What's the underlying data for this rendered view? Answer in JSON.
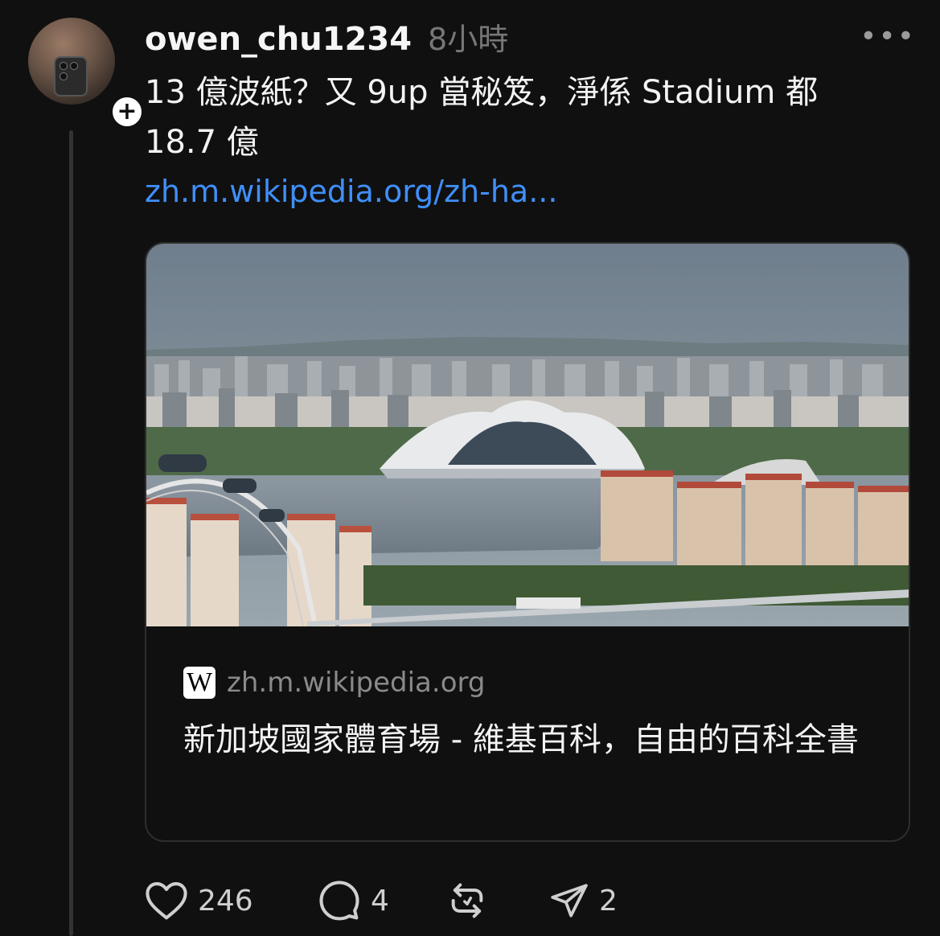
{
  "post": {
    "username": "owen_chu1234",
    "time": "8小時",
    "more_label": "•••",
    "follow_label": "+",
    "text": "13 億波紙？又 9up 當秘笈，淨係 Stadium 都 18.7 億",
    "link_text": "zh.m.wikipedia.org/zh-ha..."
  },
  "link_card": {
    "site_icon_letter": "W",
    "site_icon": "wikipedia-icon",
    "domain": "zh.m.wikipedia.org",
    "title": "新加坡國家體育場 - 維基百科，自由的百科全書"
  },
  "actions": {
    "like_count": "246",
    "comment_count": "4",
    "repost_count": "",
    "share_count": "2"
  },
  "colors": {
    "background": "#101010",
    "link": "#3f8ff7",
    "muted": "#777777",
    "thread_line": "#333333"
  }
}
